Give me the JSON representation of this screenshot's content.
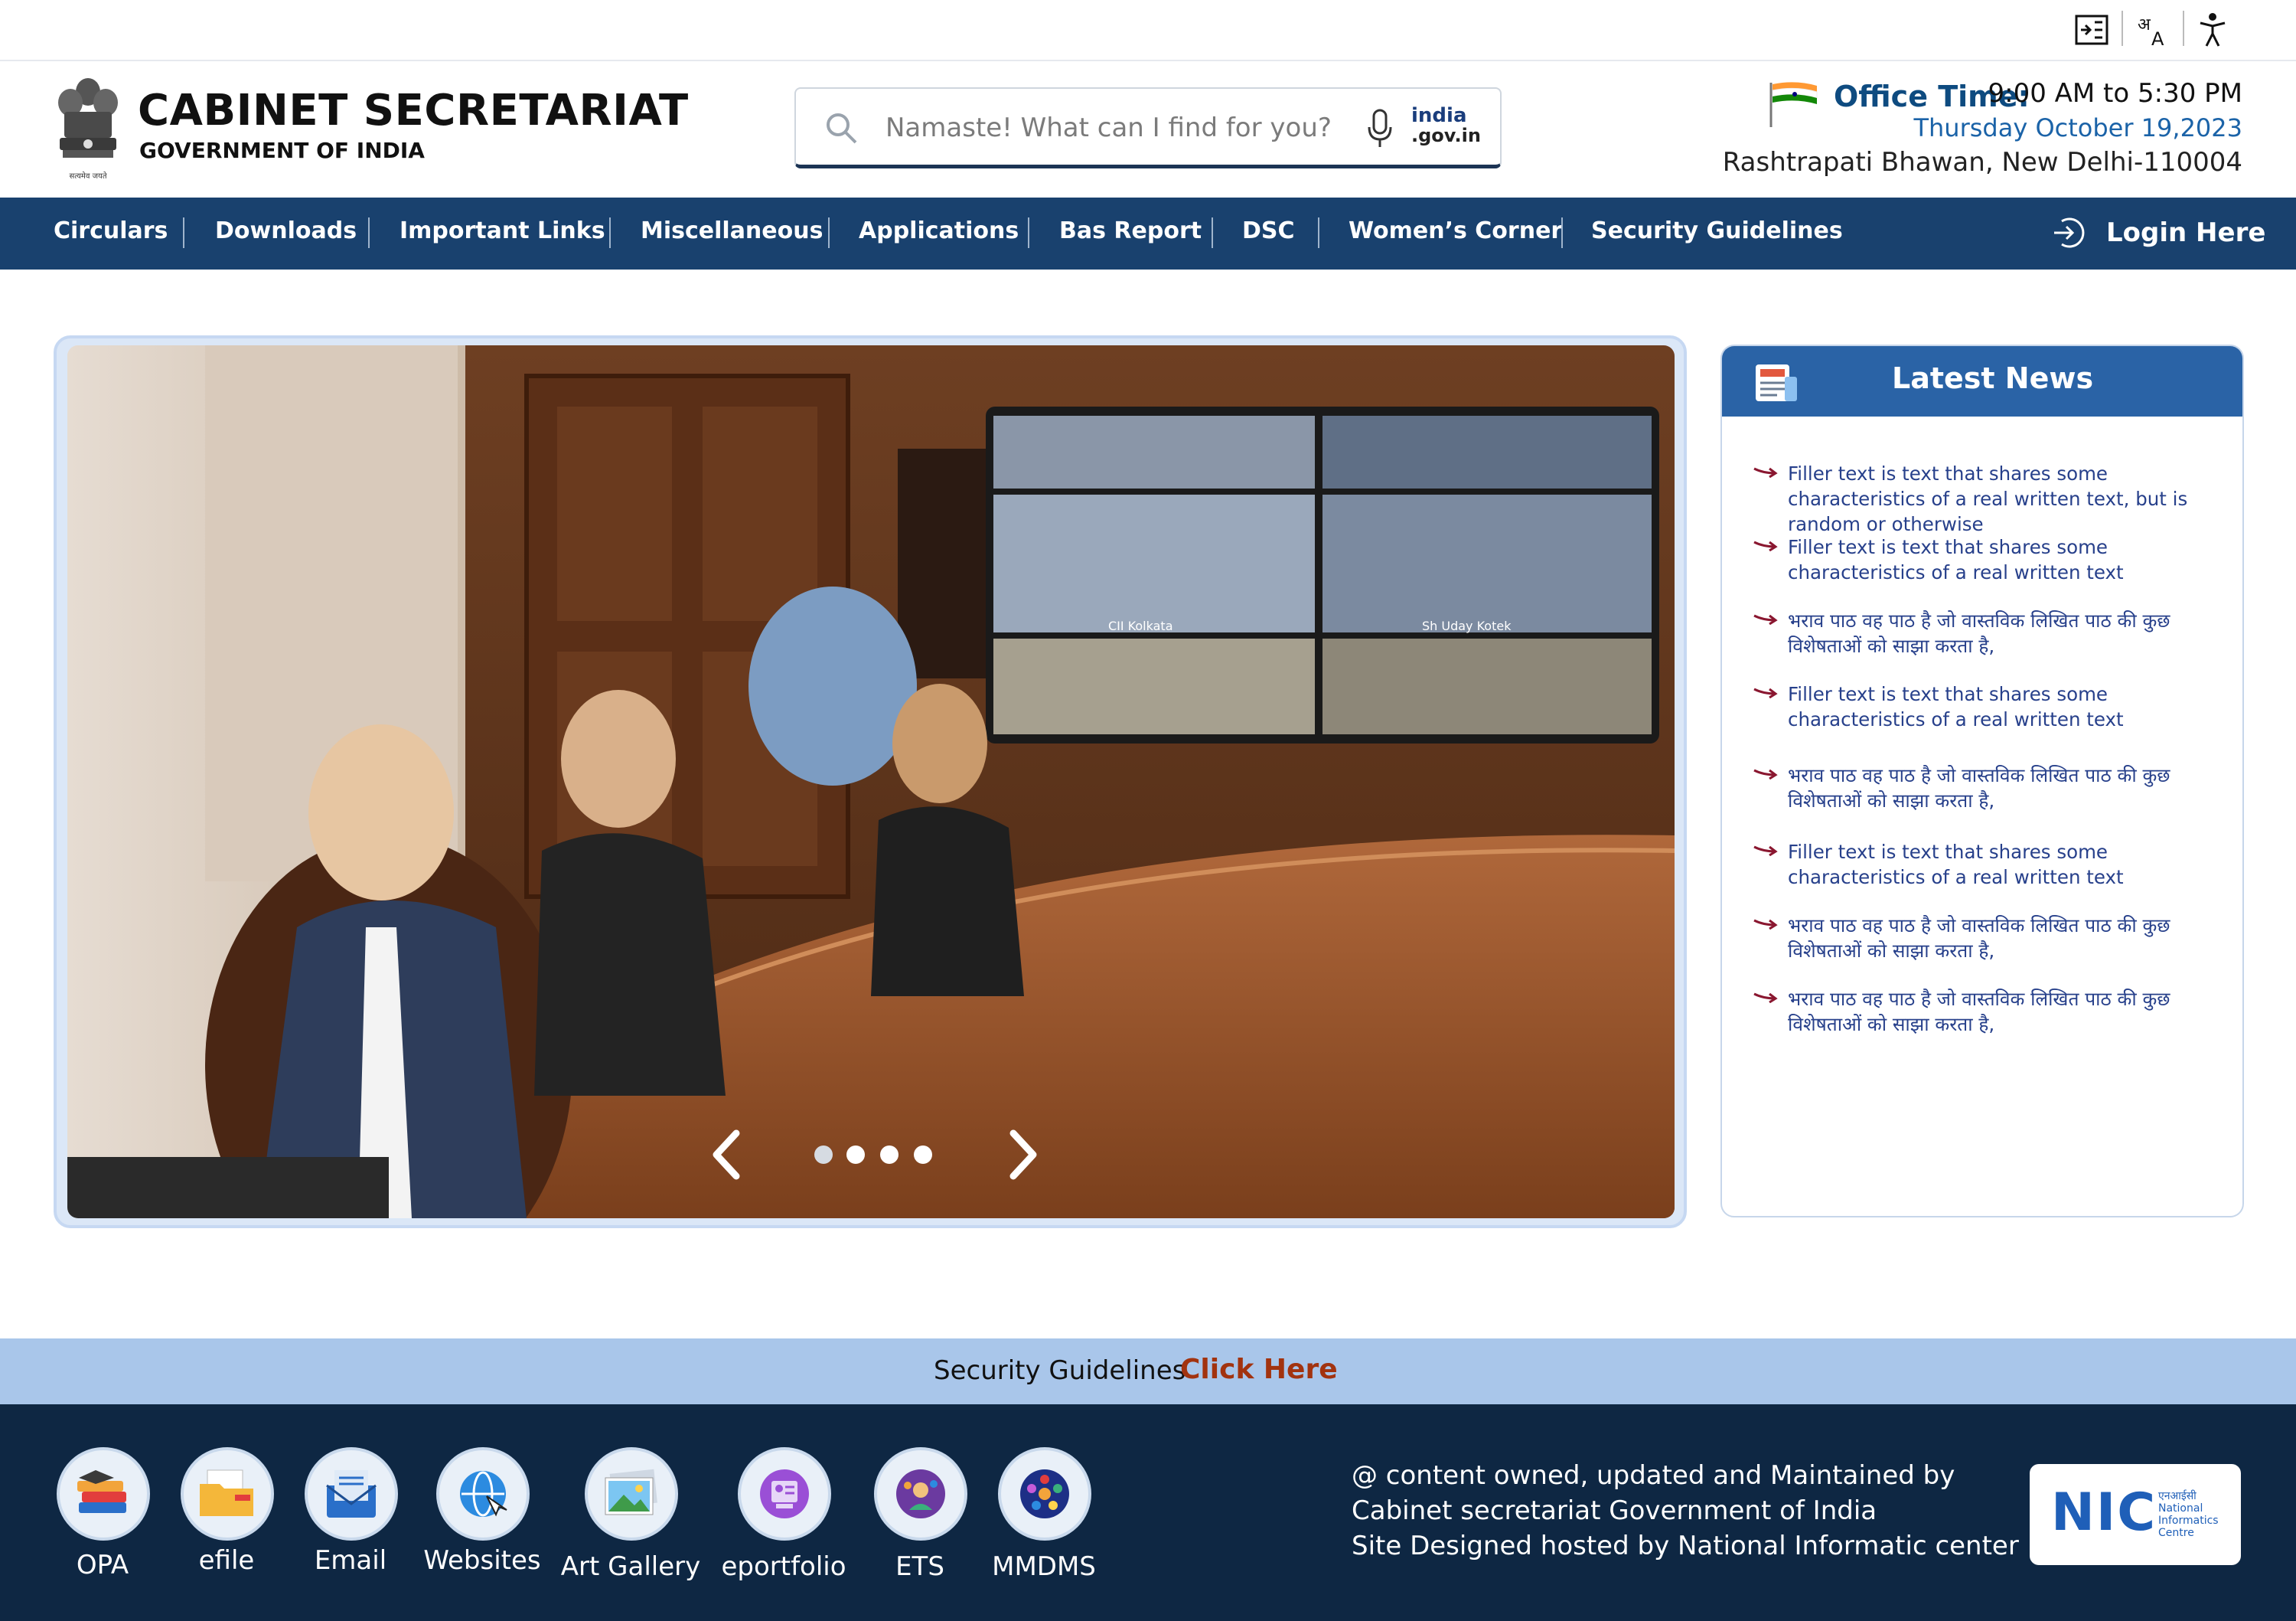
{
  "topbar": {
    "icons": [
      "skip-to-content-icon",
      "language-translate-icon",
      "accessibility-icon"
    ]
  },
  "header": {
    "title": "CABINET SECRETARIAT",
    "subtitle": "GOVERNMENT OF INDIA",
    "emblem_text": "सत्यमेव जयते",
    "search_placeholder": "Namaste! What can I find for you?",
    "india_logo_line1": "india",
    "india_logo_line2": ".gov.in",
    "office_label": "Office Time:",
    "office_hours": "9:00 AM to 5:30 PM",
    "office_date": "Thursday October 19,2023",
    "office_address": "Rashtrapati Bhawan, New Delhi-110004"
  },
  "nav": {
    "items": [
      "Circulars",
      "Downloads",
      "Important Links",
      "Miscellaneous",
      "Applications",
      "Bas Report",
      "DSC",
      "Women’s Corner",
      "Security Guidelines"
    ],
    "login": "Login Here"
  },
  "carousel": {
    "slide_count": 4,
    "active_index": 0,
    "screen_labels": [
      "CII Kolkata",
      "Sh Uday Kotek"
    ]
  },
  "news": {
    "title": "Latest News",
    "items": [
      "Filler text is text that shares some characteristics of a real written text, but is random or otherwise",
      "Filler text is text that shares some characteristics of a real written text",
      "भराव पाठ वह पाठ है जो वास्तविक लिखित पाठ की कुछ विशेषताओं को साझा करता है,",
      "Filler text is text that shares some characteristics of a real written text",
      "भराव पाठ वह पाठ है जो वास्तविक लिखित पाठ की कुछ विशेषताओं को साझा करता है,",
      "Filler text is text that shares some characteristics of a real written text",
      "भराव पाठ वह पाठ है जो वास्तविक लिखित पाठ की कुछ विशेषताओं को साझा करता है,",
      "भराव पाठ वह पाठ है जो वास्तविक लिखित पाठ की कुछ विशेषताओं को साझा करता है,"
    ]
  },
  "security": {
    "text": "Security Guidelines",
    "link": "Click Here"
  },
  "footer": {
    "apps": [
      "OPA",
      "efile",
      "Email",
      "Websites",
      "Art Gallery",
      "eportfolio",
      "ETS",
      "MMDMS"
    ],
    "lines": [
      "@ content owned, updated and Maintained by",
      "Cabinet secretariat Government of India",
      "Site Designed hosted by National Informatic center"
    ],
    "nic_abbr": "NIC",
    "nic_hindi": "एनआईसी",
    "nic_name_1": "National",
    "nic_name_2": "Informatics",
    "nic_name_3": "Centre"
  },
  "colors": {
    "nav_bg": "#19416e",
    "news_header": "#2a63a6",
    "footer_bg": "#0e2743",
    "strip_bg": "#a9c6ea",
    "link": "#a2330f"
  }
}
